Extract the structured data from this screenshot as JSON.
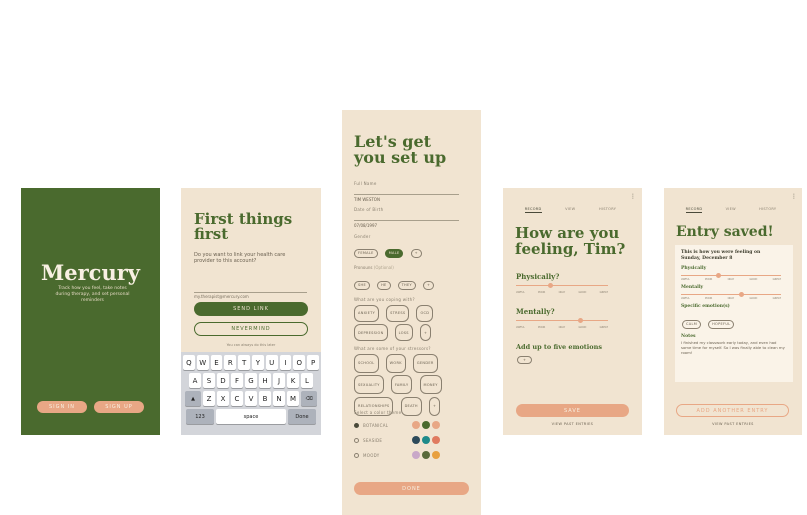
{
  "screen1": {
    "title": "Mercury",
    "tagline": "Track how you feel, take notes during therapy, and set personal reminders",
    "sign_in": "SIGN IN",
    "sign_up": "SIGN UP"
  },
  "screen2": {
    "title": "First things first",
    "question": "Do you want to link your health care provider to this account?",
    "email_placeholder": "my.therapist@mercury.com",
    "send_link": "SEND LINK",
    "nevermind": "NEVERMIND",
    "footnote": "You can always do this later",
    "keyboard": {
      "row1": [
        "Q",
        "W",
        "E",
        "R",
        "T",
        "Y",
        "U",
        "I",
        "O",
        "P"
      ],
      "row2": [
        "A",
        "S",
        "D",
        "F",
        "G",
        "H",
        "J",
        "K",
        "L"
      ],
      "row3": [
        "Z",
        "X",
        "C",
        "V",
        "B",
        "N",
        "M"
      ],
      "numbers": "123",
      "space": "space",
      "done": "Done"
    }
  },
  "screen3": {
    "title": "Let's get you set up",
    "full_name_label": "Full Name",
    "full_name_value": "TIM WESTON",
    "dob_label": "Date of Birth",
    "dob_value": "07/08/1997",
    "gender_label": "Gender",
    "genders": [
      "FEMALE",
      "MALE",
      "+"
    ],
    "pronouns_label": "Pronouns",
    "pronouns_optional": "(Optional)",
    "pronouns": [
      "SHE",
      "HE",
      "THEY",
      "+"
    ],
    "coping_label": "What are you coping with?",
    "coping": [
      "ANXIETY",
      "STRESS",
      "OCD",
      "DEPRESSION",
      "LOSS",
      "+"
    ],
    "source_label": "What are some of your stressors?",
    "sources": [
      "SCHOOL",
      "WORK",
      "GENDER",
      "SEXUALITY",
      "FAMILY",
      "MONEY",
      "RELATIONSHIPS",
      "DEATH",
      "+"
    ],
    "theme_label": "Select a color theme",
    "themes": [
      "BOTANICAL",
      "SEASIDE",
      "MOODY"
    ],
    "done": "DONE",
    "colors": {
      "botanical": [
        "#e8a785",
        "#4a6a2e",
        "#e8a785"
      ],
      "seaside": [
        "#2d4a5a",
        "#1e8a8a",
        "#e07a5f"
      ],
      "moody": [
        "#c9a8c8",
        "#5a6a3a",
        "#e8a040"
      ]
    }
  },
  "screen4": {
    "tabs": [
      "RECORD",
      "VIEW",
      "HISTORY"
    ],
    "title": "How are you feeling, Tim?",
    "physically": "Physically?",
    "mentally": "Mentally?",
    "scale": [
      "AWFUL",
      "POOR",
      "OKAY",
      "GOOD",
      "GREAT"
    ],
    "physical_level": 0.35,
    "mental_level": 0.5,
    "emotions": "Add up to five emotions",
    "add": "+",
    "save": "SAVE",
    "view_past": "VIEW PAST ENTRIES"
  },
  "screen5": {
    "tabs": [
      "RECORD",
      "VIEW",
      "HISTORY"
    ],
    "title": "Entry saved!",
    "summary": "This is how you were feeling on Sunday, December 8",
    "physically": "Physically",
    "mentally": "Mentally",
    "scale": [
      "AWFUL",
      "POOR",
      "OKAY",
      "GOOD",
      "GREAT"
    ],
    "physical_level": 0.35,
    "mental_level": 0.6,
    "emotions_label": "Specific emotion(s)",
    "emotions": [
      "CALM",
      "HOPEFUL"
    ],
    "notes_label": "Notes",
    "notes": "I finished my classwork early today, and even had some time for myself. So I was finally able to clean my room!",
    "add_another": "ADD ANOTHER ENTRY",
    "view_past": "VIEW PAST ENTRIES"
  },
  "colors": {
    "cream": "#f1e4d1",
    "green": "#4a6a2e",
    "peach": "#e8a785"
  }
}
